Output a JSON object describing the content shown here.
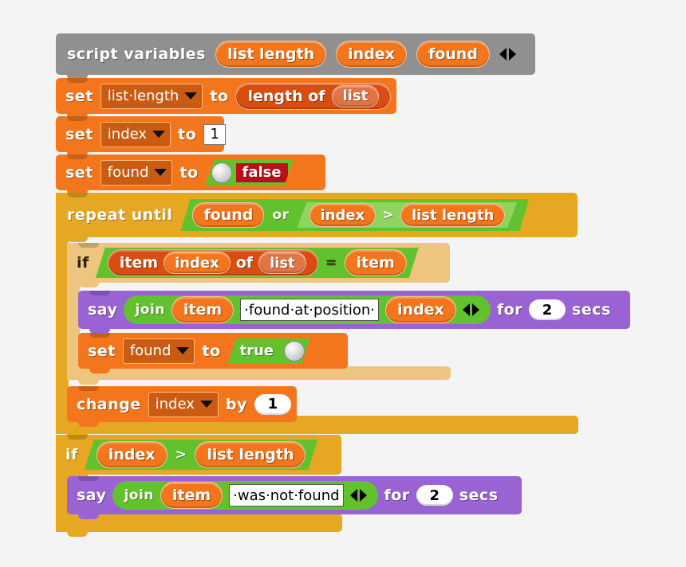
{
  "app": {
    "title": "Snap! block script",
    "canvas_background": "#f4f4f4"
  },
  "palette": {
    "other_grey": "#909090",
    "variables_orange": "#f3761d",
    "list_orange": "#d94d11",
    "control_gold": "#e6a822",
    "control_light": "#edc57e",
    "looks_purple": "#9a63d3",
    "operators_green": "#62c22d",
    "operators_light_green": "#8fd45f",
    "false_red": "#c00c17"
  },
  "script": {
    "script_variables": {
      "label": "script variables",
      "variables": [
        "list length",
        "index",
        "found"
      ],
      "arrows": "◀▶"
    },
    "set_list_length": {
      "keyword": "set",
      "dropdown_value": "list·length",
      "to": "to",
      "reporter": {
        "label": "length of",
        "argument": "list"
      }
    },
    "set_index": {
      "keyword": "set",
      "dropdown_value": "index",
      "to": "to",
      "value": "1"
    },
    "set_found_false": {
      "keyword": "set",
      "dropdown_value": "found",
      "to": "to",
      "boolean_value": "false"
    },
    "repeat_until": {
      "keyword": "repeat until",
      "condition": {
        "left": "found",
        "operator": "or",
        "right": {
          "left": "index",
          "operator": ">",
          "right": "list length"
        }
      }
    },
    "if_match": {
      "keyword": "if",
      "condition": {
        "left": {
          "label_1": "item",
          "argument_1": "index",
          "label_2": "of",
          "argument_2": "list"
        },
        "operator": "=",
        "right": "item"
      }
    },
    "say_found": {
      "keyword": "say",
      "join_label": "join",
      "join_arg_1": "item",
      "join_text": "·found·at·position·",
      "join_arg_2": "index",
      "arrows": "◀▶",
      "for_label": "for",
      "secs_value": "2",
      "secs_label": "secs"
    },
    "set_found_true": {
      "keyword": "set",
      "dropdown_value": "found",
      "to": "to",
      "boolean_value": "true"
    },
    "change_index": {
      "keyword": "change",
      "dropdown_value": "index",
      "by": "by",
      "value": "1"
    },
    "if_not_found": {
      "keyword": "if",
      "condition": {
        "left": "index",
        "operator": ">",
        "right": "list length"
      }
    },
    "say_not_found": {
      "keyword": "say",
      "join_label": "join",
      "join_arg_1": "item",
      "join_text": "·was·not·found",
      "arrows": "◀▶",
      "for_label": "for",
      "secs_value": "2",
      "secs_label": "secs"
    }
  }
}
